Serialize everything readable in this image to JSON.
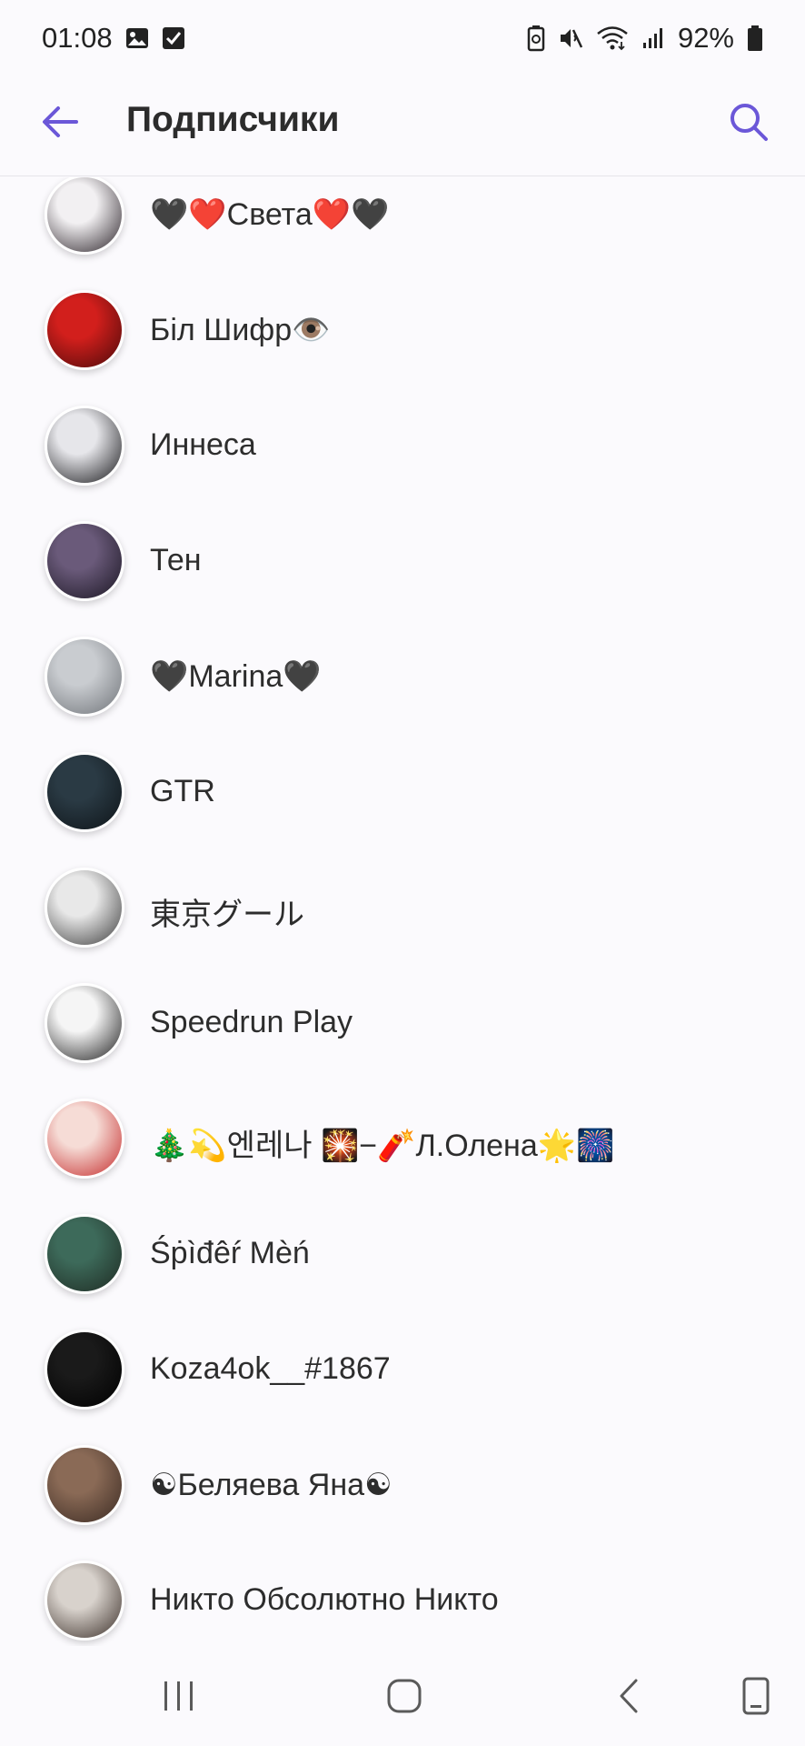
{
  "status_bar": {
    "time": "01:08",
    "battery": "92%",
    "icons": [
      "gallery-icon",
      "checkbox-icon",
      "battery-saver-icon",
      "mute-icon",
      "wifi-icon",
      "signal-icon",
      "battery-icon"
    ]
  },
  "header": {
    "title": "Подписчики",
    "back_icon": "arrow-left-icon",
    "search_icon": "search-icon"
  },
  "accent_color": "#6b57d8",
  "subscribers": [
    {
      "name": "🖤❤️Света❤️🖤",
      "avatar_colors": [
        "#f2f0f2",
        "#2a2228"
      ]
    },
    {
      "name": "Біл Шифр👁️",
      "avatar_colors": [
        "#d21f1c",
        "#4a0a0a"
      ]
    },
    {
      "name": "Иннеса",
      "avatar_colors": [
        "#e6e6ea",
        "#151518"
      ]
    },
    {
      "name": "Тен",
      "avatar_colors": [
        "#6a5a7a",
        "#1a1622"
      ]
    },
    {
      "name": "🖤Marina🖤",
      "avatar_colors": [
        "#c9ccd0",
        "#6f7378"
      ]
    },
    {
      "name": "GTR",
      "avatar_colors": [
        "#2a3a44",
        "#0e1418"
      ]
    },
    {
      "name": "東京グール",
      "avatar_colors": [
        "#e8e8e8",
        "#3c3c3c"
      ]
    },
    {
      "name": "Speedrun Play",
      "avatar_colors": [
        "#f5f5f5",
        "#1c1c1c"
      ]
    },
    {
      "name": "🎄💫엔레나 🎇−🧨Л.Олена🌟🎆",
      "avatar_colors": [
        "#f6dcd6",
        "#c42a2a"
      ]
    },
    {
      "name": "Śṗìđêŕ Mèń",
      "avatar_colors": [
        "#3d6a5a",
        "#1e2a22"
      ]
    },
    {
      "name": "Koza4ok__#1867",
      "avatar_colors": [
        "#1a1a1a",
        "#000000"
      ]
    },
    {
      "name": "☯Беляева Яна☯",
      "avatar_colors": [
        "#8a6a56",
        "#3a2a22"
      ]
    },
    {
      "name": "Никто Обсолютно Никто",
      "avatar_colors": [
        "#d8d2cc",
        "#3a2e28"
      ]
    }
  ],
  "nav_bar": {
    "icons": [
      "recent-apps-icon",
      "home-icon",
      "back-icon",
      "screenshot-icon"
    ]
  }
}
